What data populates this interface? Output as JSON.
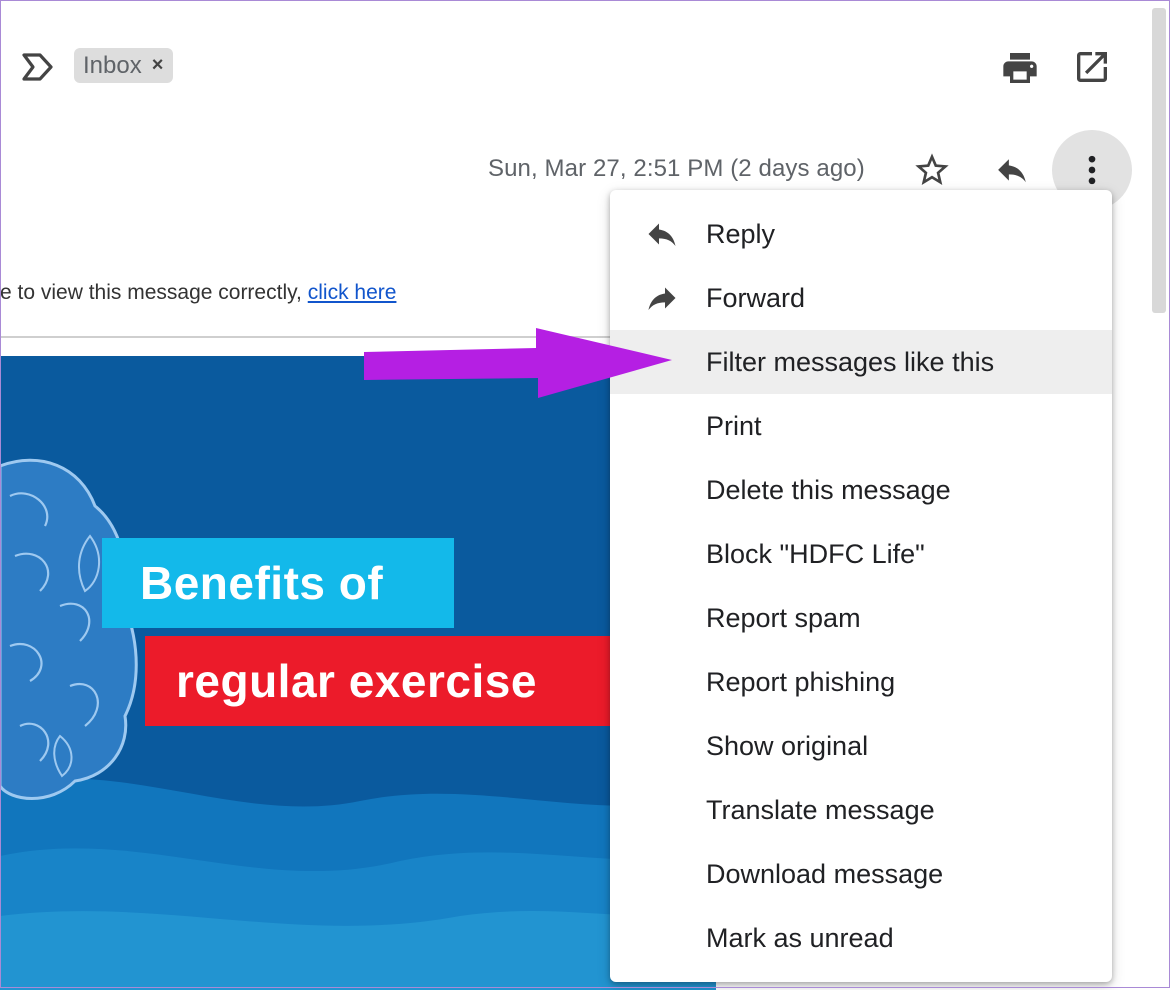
{
  "toolbar": {
    "label_chip": "Inbox",
    "chip_close": "×",
    "icons": [
      "label-icon",
      "print-icon",
      "open-in-new-window-icon"
    ]
  },
  "header": {
    "date": "Sun, Mar 27, 2:51 PM (2 days ago)",
    "icons": [
      "star-icon",
      "reply-icon",
      "more-vert-icon"
    ]
  },
  "message": {
    "notice_text": "e to view this message correctly, ",
    "notice_link": "click here",
    "banner": {
      "line1": "Benefits of",
      "line2": "regular exercise"
    }
  },
  "menu": {
    "items": [
      {
        "label": "Reply",
        "icon": "reply-icon"
      },
      {
        "label": "Forward",
        "icon": "forward-icon"
      },
      {
        "label": "Filter messages like this",
        "highlighted": true
      },
      {
        "label": "Print"
      },
      {
        "label": "Delete this message"
      },
      {
        "label": "Block \"HDFC Life\""
      },
      {
        "label": "Report spam"
      },
      {
        "label": "Report phishing"
      },
      {
        "label": "Show original"
      },
      {
        "label": "Translate message"
      },
      {
        "label": "Download message"
      },
      {
        "label": "Mark as unread"
      }
    ]
  },
  "colors": {
    "annotation_arrow": "#b51fe3",
    "banner_blue": "#0a5a9e",
    "banner_cyan": "#13b9ea",
    "banner_red": "#ec1b2a",
    "menu_highlight": "#eeeeee",
    "link": "#1155cc"
  }
}
